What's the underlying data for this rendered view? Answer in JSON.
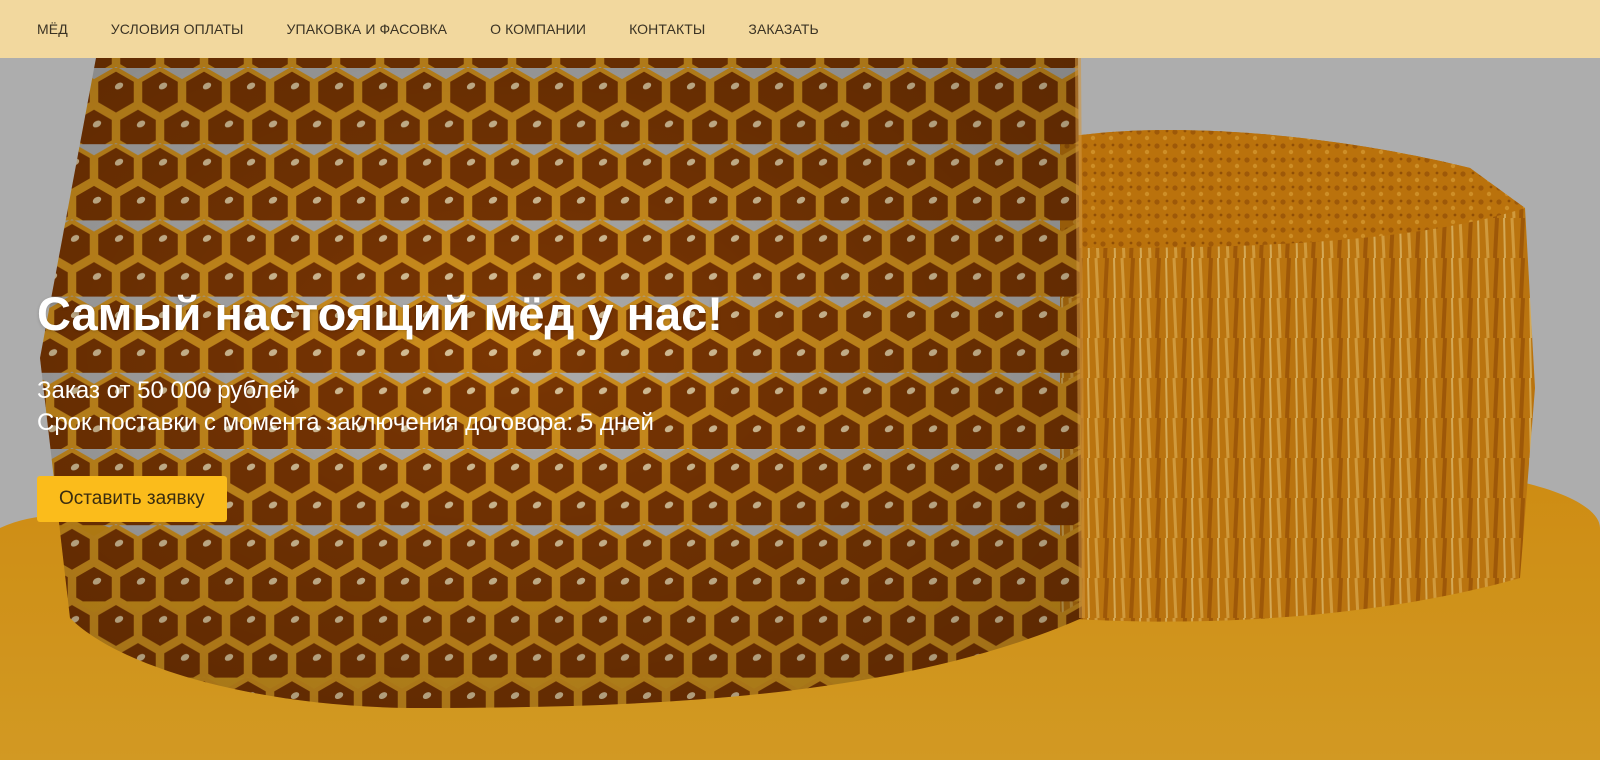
{
  "nav": {
    "items": [
      {
        "label": "МЁД"
      },
      {
        "label": "УСЛОВИЯ ОПЛАТЫ"
      },
      {
        "label": "УПАКОВКА И ФАСОВКА"
      },
      {
        "label": "О КОМПАНИИ"
      },
      {
        "label": "КОНТАКТЫ"
      },
      {
        "label": "ЗАКАЗАТЬ"
      }
    ]
  },
  "hero": {
    "title": "Самый настоящий мёд у нас!",
    "line1": "Заказ от 50 000 рублей",
    "line2": "Срок поставки с момента заключения договора: 5 дней",
    "cta_label": "Оставить заявку"
  },
  "colors": {
    "nav_background": "#f2d89e",
    "cta_background": "#fbbc1b",
    "honey": "#e9900f",
    "hero_overlay": "#c6c6c6"
  }
}
